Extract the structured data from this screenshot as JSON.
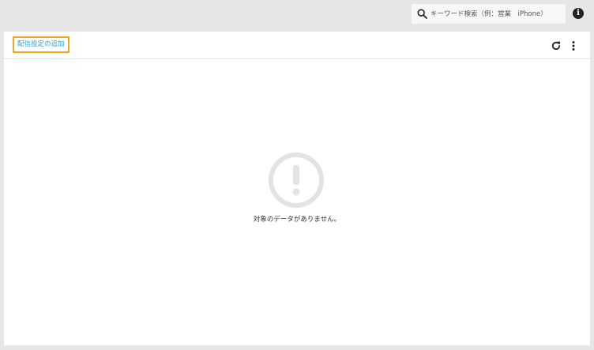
{
  "header": {
    "search": {
      "placeholder": "キーワード検索（例：営業　iPhone）",
      "value": ""
    },
    "info_icon": "info-icon"
  },
  "toolbar": {
    "add_label": "配信設定の追加",
    "refresh_icon": "refresh-icon",
    "more_icon": "more-vertical-icon"
  },
  "empty_state": {
    "icon": "exclamation-circle-icon",
    "message": "対象のデータがありません。"
  },
  "colors": {
    "accent": "#2a9fd6",
    "highlight_border": "#f2a623",
    "background": "#e6e6e6",
    "empty_icon": "#e3e3e3"
  }
}
